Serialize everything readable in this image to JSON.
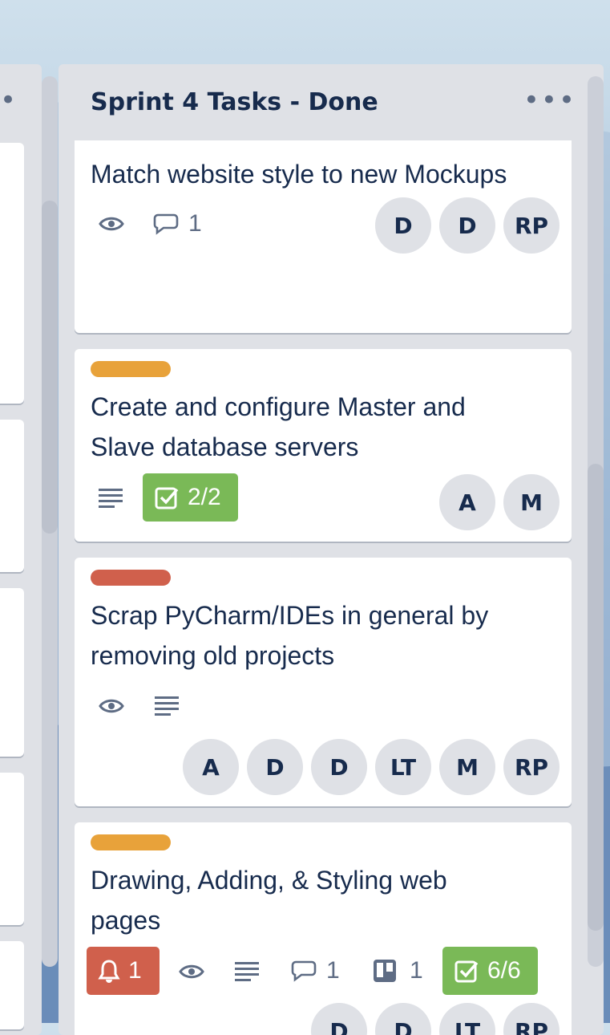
{
  "list": {
    "title": "Sprint 4 Tasks - Done",
    "menu_icon": "more-horizontal-icon"
  },
  "colors": {
    "label_orange": "#e8a23a",
    "label_red": "#d0604c",
    "checklist_green": "#7ab957",
    "notification_red": "#d0604c"
  },
  "cards": [
    {
      "label_color": "orange",
      "title": "Match website style to new Mockups",
      "badges": {
        "watching": true,
        "comments": "1"
      },
      "members": [
        "D",
        "D",
        "RP"
      ]
    },
    {
      "label_color": "orange",
      "title_line1": "Create and configure Master and",
      "title_line2": "Slave database servers",
      "badges": {
        "description": true,
        "checklist": "2/2"
      },
      "members": [
        "A",
        "M"
      ]
    },
    {
      "label_color": "red",
      "title_line1": "Scrap PyCharm/IDEs in general by",
      "title_line2": "removing old projects",
      "badges": {
        "watching": true,
        "description": true
      },
      "members": [
        "A",
        "D",
        "D",
        "LT",
        "M",
        "RP"
      ]
    },
    {
      "label_color": "orange",
      "title_line1": "Drawing, Adding, & Styling web",
      "title_line2": "pages",
      "badges": {
        "notifications": "1",
        "watching": true,
        "description": true,
        "comments": "1",
        "attachments": "1",
        "checklist": "6/6"
      },
      "members": [
        "D",
        "D",
        "LT",
        "RP"
      ]
    }
  ]
}
